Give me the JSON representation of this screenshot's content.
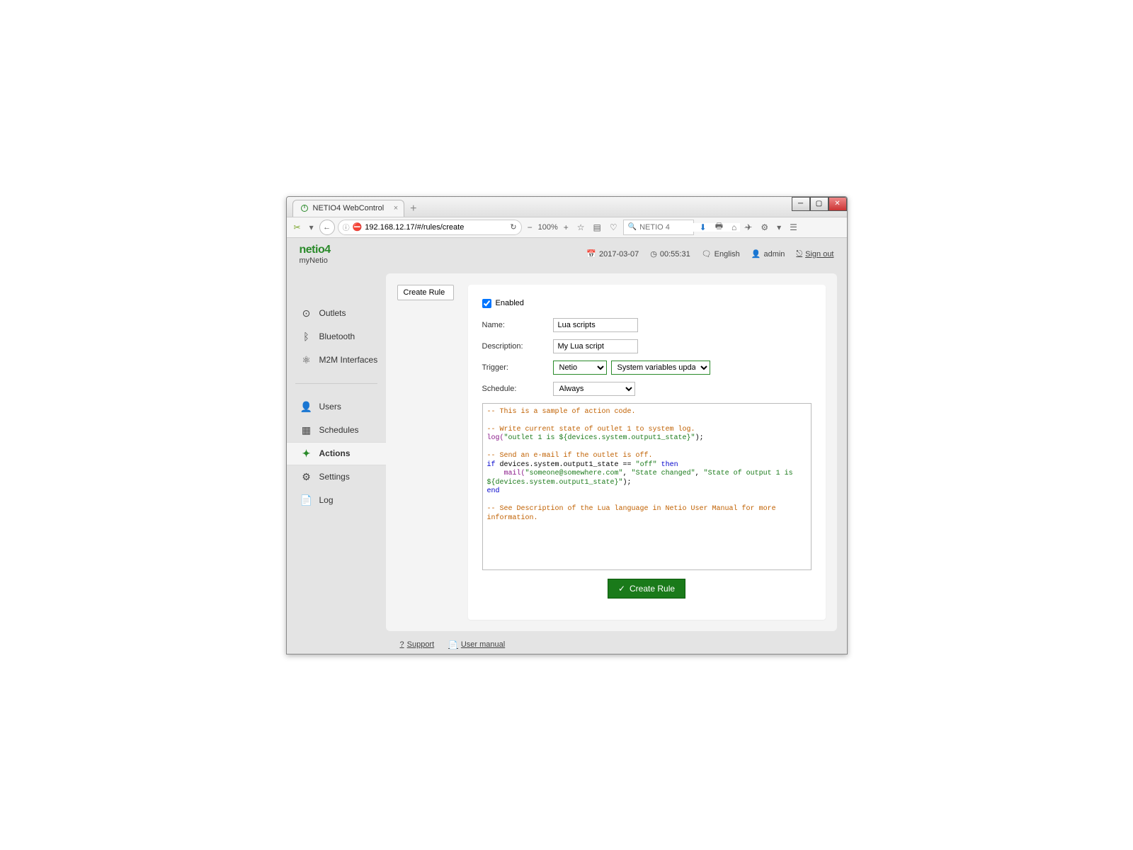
{
  "browser": {
    "tab_title": "NETIO4 WebControl",
    "url": "192.168.12.17/#/rules/create",
    "zoom": "100%",
    "search_placeholder": "NETIO 4"
  },
  "header": {
    "logo": "netio4",
    "logo_sub": "myNetio",
    "date": "2017-03-07",
    "time": "00:55:31",
    "language": "English",
    "user": "admin",
    "signout": "Sign out"
  },
  "sidebar": {
    "items": [
      {
        "label": "Outlets"
      },
      {
        "label": "Bluetooth"
      },
      {
        "label": "M2M Interfaces"
      },
      {
        "label": "Users"
      },
      {
        "label": "Schedules"
      },
      {
        "label": "Actions"
      },
      {
        "label": "Settings"
      },
      {
        "label": "Log"
      }
    ]
  },
  "page": {
    "tab_label": "Create Rule",
    "enabled_label": "Enabled",
    "name_label": "Name:",
    "name_value": "Lua scripts",
    "desc_label": "Description:",
    "desc_value": "My Lua script",
    "trigger_label": "Trigger:",
    "trigger_category": "Netio",
    "trigger_event": "System variables updated",
    "schedule_label": "Schedule:",
    "schedule_value": "Always",
    "submit_label": "Create Rule",
    "code": {
      "c1": "-- This is a sample of action code.",
      "c2": "-- Write current state of outlet 1 to system log.",
      "l1a": "log(",
      "l1b": "\"outlet 1 is ${devices.system.output1_state}\"",
      "l1c": ");",
      "c3": "-- Send an e-mail if the outlet is off.",
      "l2a": "if",
      "l2b": " devices.system.output1_state == ",
      "l2c": "\"off\"",
      "l2d": " then",
      "l3a": "    mail(",
      "l3b": "\"someone@somewhere.com\"",
      "l3c": ", ",
      "l3d": "\"State changed\"",
      "l3e": ", ",
      "l3f": "\"State of output 1 is ${devices.system.output1_state}\"",
      "l3g": ");",
      "l4": "end",
      "c4": "-- See Description of the Lua language in Netio User Manual for more information."
    }
  },
  "footer": {
    "support": "Support",
    "manual": "User manual"
  }
}
